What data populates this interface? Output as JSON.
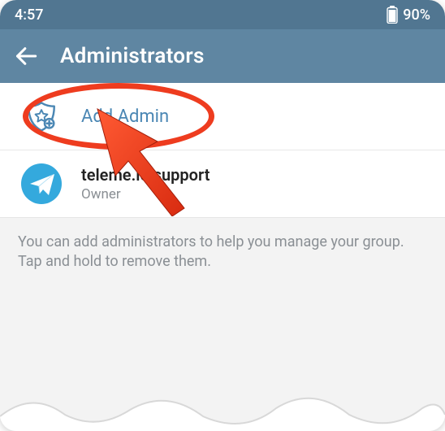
{
  "status": {
    "time": "4:57",
    "battery_pct": "90%"
  },
  "header": {
    "title": "Administrators"
  },
  "add_admin": {
    "label": "Add Admin"
  },
  "admins": [
    {
      "name": "teleme.io support",
      "role": "Owner"
    }
  ],
  "help_text": "You can add administrators to help you manage your group. Tap and hold to remove them.",
  "colors": {
    "statusbar": "#517691",
    "header": "#5f86a2",
    "accent": "#4b87b4",
    "avatar": "#34a9dd",
    "annotation": "#ee3c1f"
  },
  "annotation": {
    "target": "add-admin-row",
    "shape": "ellipse+arrow"
  }
}
